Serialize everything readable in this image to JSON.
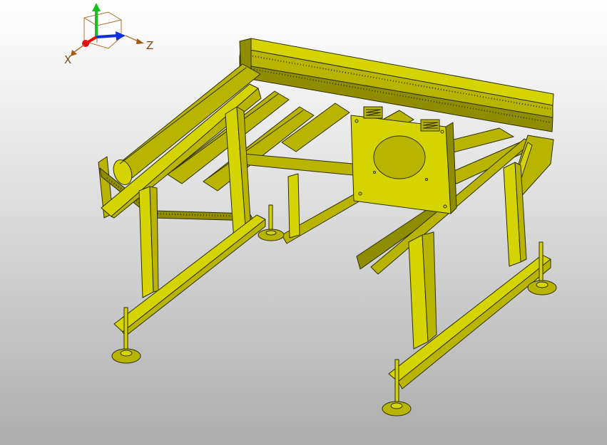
{
  "viewport": {
    "background_top": "#ffffff",
    "background_bottom": "#adadad",
    "model_color": "#b8b400",
    "edge_color": "#2e2e00"
  },
  "triad": {
    "axes": {
      "x": {
        "label": "X",
        "color": "#e01010"
      },
      "y": {
        "label": "",
        "color": "#18c018"
      },
      "z": {
        "label": "Z",
        "color": "#1030e0"
      }
    }
  }
}
